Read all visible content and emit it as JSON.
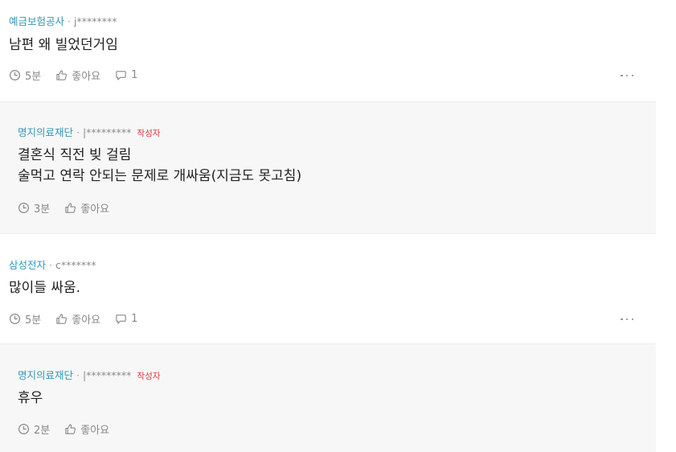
{
  "comments": [
    {
      "company": "예금보험공사",
      "separator": "·",
      "user": "j********",
      "lines": [
        "남편 왜 빌었던거임"
      ],
      "time": "5분",
      "like_label": "좋아요",
      "reply_count": "1"
    },
    {
      "company": "명지의료재단",
      "separator": "·",
      "user": "|*********",
      "author_tag": "작성자",
      "lines": [
        "결혼식 직전 빚 걸림",
        "술먹고 연락 안되는 문제로 개싸움(지금도 못고침)"
      ],
      "time": "3분",
      "like_label": "좋아요"
    },
    {
      "company": "삼성전자",
      "separator": "·",
      "user": "c*******",
      "lines": [
        "많이들 싸움."
      ],
      "time": "5분",
      "like_label": "좋아요",
      "reply_count": "1"
    },
    {
      "company": "명지의료재단",
      "separator": "·",
      "user": "|*********",
      "author_tag": "작성자",
      "lines": [
        "휴우"
      ],
      "time": "2분",
      "like_label": "좋아요"
    }
  ]
}
